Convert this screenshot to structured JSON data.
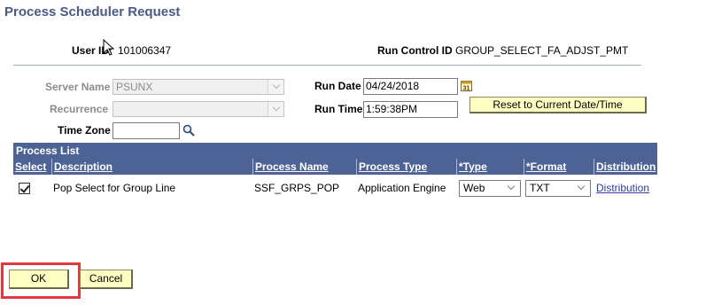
{
  "page": {
    "title": "Process Scheduler Request"
  },
  "header": {
    "user_id_label": "User ID:",
    "user_id_value": "101006347",
    "run_control_label": "Run Control ID",
    "run_control_value": "GROUP_SELECT_FA_ADJST_PMT"
  },
  "form": {
    "server_name_label": "Server Name",
    "server_name_value": "PSUNX",
    "recurrence_label": "Recurrence",
    "recurrence_value": "",
    "time_zone_label": "Time Zone",
    "time_zone_value": "",
    "run_date_label": "Run Date",
    "run_date_value": "04/24/2018",
    "run_time_label": "Run Time",
    "run_time_value": "1:59:38PM",
    "reset_button_label": "Reset to Current Date/Time"
  },
  "process_list": {
    "title": "Process List",
    "columns": [
      "Select",
      "Description",
      "Process Name",
      "Process Type",
      "*Type",
      "*Format",
      "Distribution"
    ],
    "rows": [
      {
        "selected": true,
        "description": "Pop Select for Group Line",
        "process_name": "SSF_GRPS_POP",
        "process_type": "Application Engine",
        "type": "Web",
        "format": "TXT",
        "distribution": "Distribution"
      }
    ]
  },
  "actions": {
    "ok_label": "OK",
    "cancel_label": "Cancel"
  },
  "colors": {
    "title": "#4a5a84",
    "grid_header": "#4d6396",
    "button_face": "#ffffc4",
    "highlight_outline": "#e0393e",
    "link": "#2d3e9c"
  },
  "icons": [
    "calendar-icon",
    "search-icon",
    "checkbox-checked-icon",
    "chevron-down-icon",
    "mouse-cursor-icon"
  ]
}
